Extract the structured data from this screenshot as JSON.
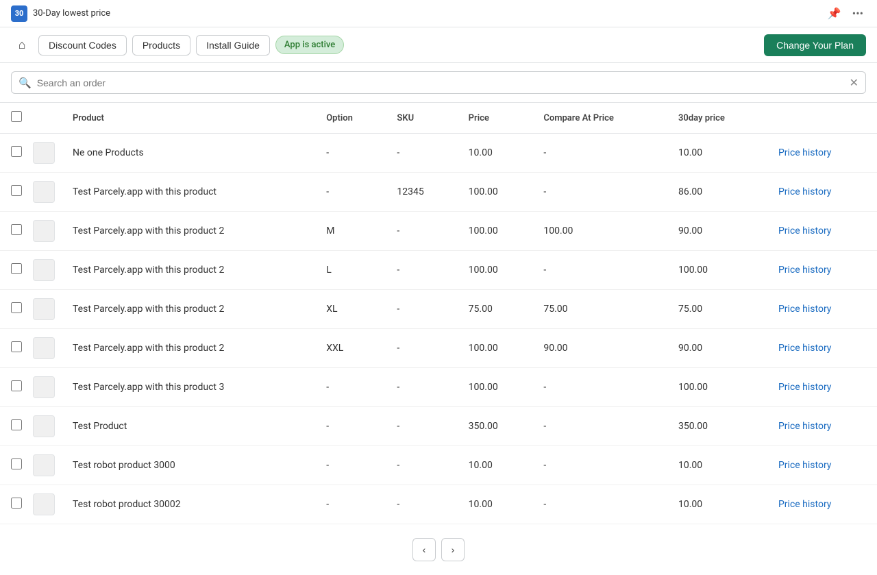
{
  "topBar": {
    "logoText": "30",
    "title": "30-Day lowest price",
    "pinIcon": "📌",
    "moreIcon": "•••"
  },
  "navBar": {
    "homeIcon": "⌂",
    "discountCodes": "Discount Codes",
    "products": "Products",
    "installGuide": "Install Guide",
    "appStatus": "App is active",
    "changePlan": "Change Your Plan"
  },
  "search": {
    "placeholder": "Search an order",
    "clearIcon": "✕"
  },
  "table": {
    "headers": [
      "",
      "",
      "Product",
      "Option",
      "SKU",
      "Price",
      "Compare At Price",
      "30day price",
      ""
    ],
    "rows": [
      {
        "product": "Ne one Products",
        "option": "-",
        "sku": "-",
        "price": "10.00",
        "compareAt": "-",
        "thirtyDay": "10.00"
      },
      {
        "product": "Test Parcely.app with this product",
        "option": "-",
        "sku": "12345",
        "price": "100.00",
        "compareAt": "-",
        "thirtyDay": "86.00"
      },
      {
        "product": "Test Parcely.app with this product 2",
        "option": "M",
        "sku": "-",
        "price": "100.00",
        "compareAt": "100.00",
        "thirtyDay": "90.00"
      },
      {
        "product": "Test Parcely.app with this product 2",
        "option": "L",
        "sku": "-",
        "price": "100.00",
        "compareAt": "-",
        "thirtyDay": "100.00"
      },
      {
        "product": "Test Parcely.app with this product 2",
        "option": "XL",
        "sku": "-",
        "price": "75.00",
        "compareAt": "75.00",
        "thirtyDay": "75.00"
      },
      {
        "product": "Test Parcely.app with this product 2",
        "option": "XXL",
        "sku": "-",
        "price": "100.00",
        "compareAt": "90.00",
        "thirtyDay": "90.00"
      },
      {
        "product": "Test Parcely.app with this product 3",
        "option": "-",
        "sku": "-",
        "price": "100.00",
        "compareAt": "-",
        "thirtyDay": "100.00"
      },
      {
        "product": "Test Product",
        "option": "-",
        "sku": "-",
        "price": "350.00",
        "compareAt": "-",
        "thirtyDay": "350.00"
      },
      {
        "product": "Test robot product 3000",
        "option": "-",
        "sku": "-",
        "price": "10.00",
        "compareAt": "-",
        "thirtyDay": "10.00"
      },
      {
        "product": "Test robot product 30002",
        "option": "-",
        "sku": "-",
        "price": "10.00",
        "compareAt": "-",
        "thirtyDay": "10.00"
      }
    ],
    "priceHistoryLink": "Price history"
  },
  "pagination": {
    "prevIcon": "‹",
    "nextIcon": "›"
  }
}
